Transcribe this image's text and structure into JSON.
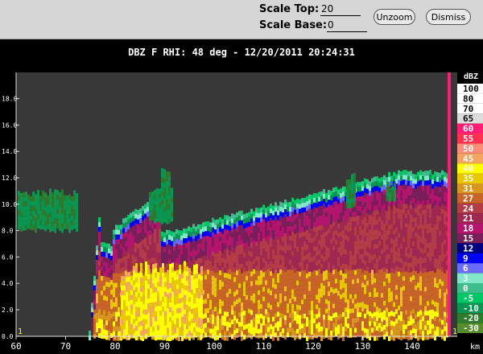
{
  "toolbar": {
    "scale_top_label": "Scale Top:",
    "scale_top_value": "20",
    "scale_base_label": "Scale Base:",
    "scale_base_value": "0",
    "unzoom_label": "Unzoom",
    "dismiss_label": "Dismiss"
  },
  "plot_title": "DBZ F  RHI: 48 deg  -  12/20/2011 20:24:31",
  "axes": {
    "x_unit": "km",
    "x_ticks": [
      "60",
      "70",
      "80",
      "90",
      "100",
      "110",
      "120",
      "130",
      "140"
    ],
    "y_ticks": [
      "18.0",
      "16.0",
      "14.0",
      "12.0",
      "10.0",
      "8.0",
      "6.0",
      "4.0",
      "2.0",
      "0.0"
    ]
  },
  "corner_marks": {
    "left": "1",
    "right": "1"
  },
  "colorbar": {
    "title": "dBZ",
    "entries": [
      {
        "label": "100",
        "color": "#ffffff"
      },
      {
        "label": "80",
        "color": "#ffffff"
      },
      {
        "label": "70",
        "color": "#ffffff"
      },
      {
        "label": "65",
        "color": "#dcdcdc"
      },
      {
        "label": "60",
        "color": "#ff1e74"
      },
      {
        "label": "55",
        "color": "#ff3050"
      },
      {
        "label": "50",
        "color": "#ff8c78"
      },
      {
        "label": "45",
        "color": "#f2a460"
      },
      {
        "label": "40",
        "color": "#ffff00"
      },
      {
        "label": "35",
        "color": "#e8c800"
      },
      {
        "label": "31",
        "color": "#d9961e"
      },
      {
        "label": "27",
        "color": "#c86428"
      },
      {
        "label": "24",
        "color": "#b43c46"
      },
      {
        "label": "21",
        "color": "#a02850"
      },
      {
        "label": "18",
        "color": "#b4146e"
      },
      {
        "label": "15",
        "color": "#7a1e5a"
      },
      {
        "label": "12",
        "color": "#000080"
      },
      {
        "label": "9",
        "color": "#0000ff"
      },
      {
        "label": "6",
        "color": "#6a6aff"
      },
      {
        "label": "3",
        "color": "#82e6c8"
      },
      {
        "label": "0",
        "color": "#3cbe8c"
      },
      {
        "label": "-5",
        "color": "#00c864"
      },
      {
        "label": "-10",
        "color": "#0a9650"
      },
      {
        "label": "-20",
        "color": "#2d7a2d"
      },
      {
        "label": "-30",
        "color": "#558c2d"
      }
    ]
  }
}
